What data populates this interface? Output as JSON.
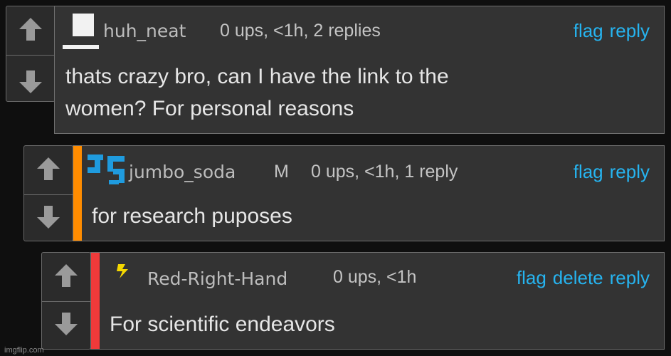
{
  "comments": [
    {
      "username": "huh_neat",
      "mod_badge": "",
      "meta": "0 ups, <1h, 2 replies",
      "actions": [
        "flag",
        "reply"
      ],
      "text_lines": [
        "thats crazy bro, can I have the link to the",
        "women? For personal reasons"
      ],
      "stripe_color": "",
      "avatar": "white-block-avatar"
    },
    {
      "username": "jumbo_soda",
      "mod_badge": "M",
      "meta": "0 ups, <1h, 1 reply",
      "actions": [
        "flag",
        "reply"
      ],
      "text_lines": [
        "for research puposes"
      ],
      "stripe_color": "#ff8c00",
      "avatar": "blue-pixel-avatar"
    },
    {
      "username": "Red-Right-Hand",
      "mod_badge": "",
      "meta": "0 ups, <1h",
      "actions": [
        "flag",
        "delete",
        "reply"
      ],
      "text_lines": [
        "For scientific endeavors"
      ],
      "stripe_color": "#f03a3a",
      "avatar": "yellow-lightning-avatar"
    }
  ],
  "watermark": "imgflip.com",
  "colors": {
    "action_link": "#26b4f0",
    "background": "#0f0f0f",
    "card": "#333333"
  },
  "icons": {
    "upvote": "up-arrow-icon",
    "downvote": "down-arrow-icon"
  }
}
